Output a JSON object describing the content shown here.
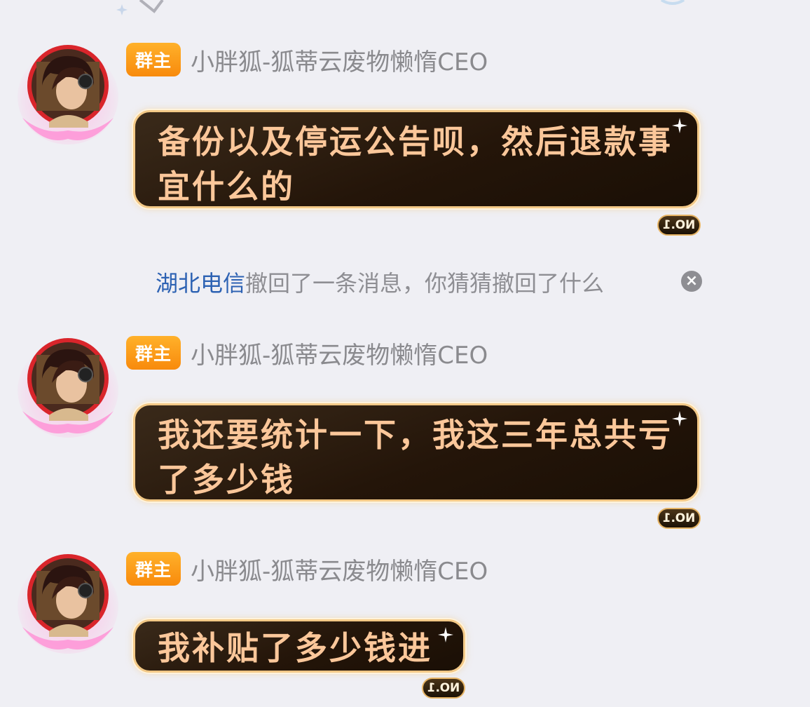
{
  "messages": [
    {
      "badge": "群主",
      "sender": "小胖狐-狐蒂云废物懒惰CEO",
      "text": "备份以及停运公告呗，然后退款事宜什么的",
      "tag": "NO.1"
    },
    {
      "badge": "群主",
      "sender": "小胖狐-狐蒂云废物懒惰CEO",
      "text": "我还要统计一下，我这三年总共亏了多少钱",
      "tag": "NO.1"
    },
    {
      "badge": "群主",
      "sender": "小胖狐-狐蒂云废物懒惰CEO",
      "text": "我补贴了多少钱进",
      "tag": "NO.1"
    }
  ],
  "recall_notice": {
    "user": "湖北电信",
    "text": "撤回了一条消息，你猜猜撤回了什么",
    "close_icon": "close-circle-icon"
  },
  "icons": {
    "avatar": "anime-girl-avatar",
    "sparkle": "sparkle-icon",
    "avatar_frame": "pink-wing-frame"
  },
  "colors": {
    "background": "#efeff4",
    "badge": "#f88a0c",
    "bubble_bg": "#241509",
    "bubble_border": "#f3c987",
    "bubble_text": "#fbc79a",
    "sender_text": "#8a8a8e",
    "recall_user": "#2d62b3"
  }
}
